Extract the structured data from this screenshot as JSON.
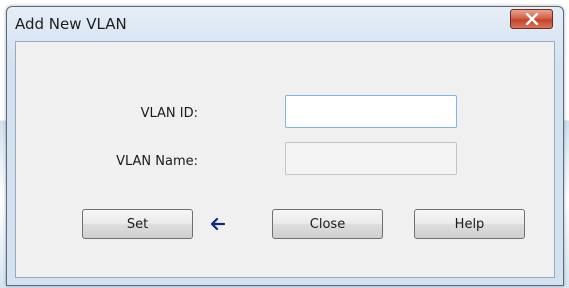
{
  "dialog": {
    "title": "Add New VLAN",
    "close_icon": "close-x-icon"
  },
  "form": {
    "vlan_id_label": "VLAN ID:",
    "vlan_id_value": "",
    "vlan_name_label": "VLAN Name:",
    "vlan_name_value": ""
  },
  "buttons": {
    "set_label": "Set",
    "close_label": "Close",
    "help_label": "Help"
  },
  "indicator": {
    "icon": "left-arrow-icon",
    "color": "#0b2a8a"
  },
  "colors": {
    "close_button": "#c9472d",
    "focus_border": "#7eb4ea"
  }
}
